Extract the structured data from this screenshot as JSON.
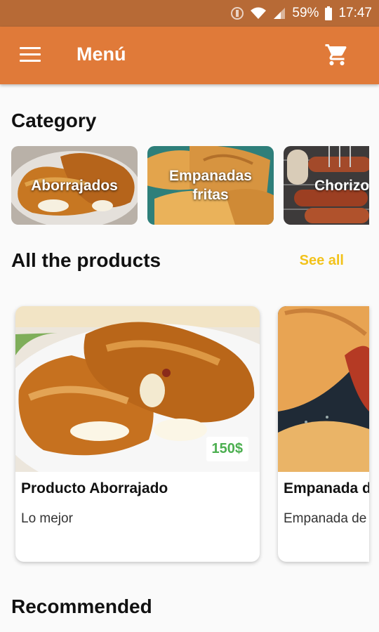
{
  "status_bar": {
    "battery": "59%",
    "time": "17:47"
  },
  "app_bar": {
    "title": "Menú"
  },
  "sections": {
    "category": "Category",
    "all_products": "All the products",
    "see_all": "See all",
    "recommended": "Recommended"
  },
  "categories": [
    {
      "label": "Aborrajados"
    },
    {
      "label": "Empanadas\nfritas"
    },
    {
      "label": "Chorizo"
    }
  ],
  "products": [
    {
      "name": "Producto Aborrajado",
      "description": "Lo mejor",
      "price": "150$"
    },
    {
      "name": "Empanada de",
      "description": "Empanada de"
    }
  ],
  "colors": {
    "primary": "#e07a39",
    "status_bar": "#b76a36",
    "accent": "#f2c21b",
    "price": "#4caf50"
  }
}
